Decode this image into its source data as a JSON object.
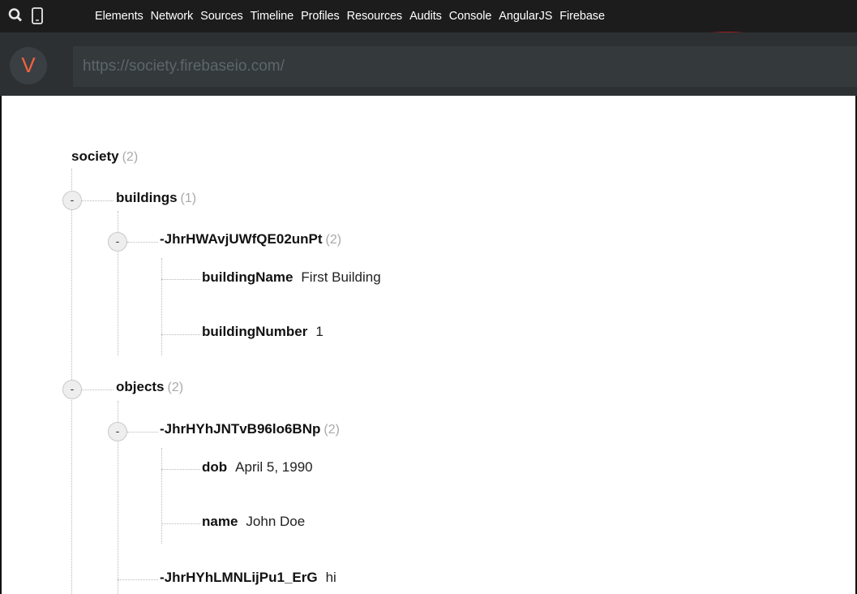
{
  "devtools": {
    "tabs": [
      "Elements",
      "Network",
      "Sources",
      "Timeline",
      "Profiles",
      "Resources",
      "Audits",
      "Console",
      "AngularJS",
      "Firebase"
    ],
    "highlight_color": "#e21b1b"
  },
  "firebase": {
    "logo_letter": "V",
    "url_placeholder": "https://society.firebaseio.com/"
  },
  "tree": {
    "root": {
      "key": "society",
      "count": "(2)"
    },
    "buildings": {
      "key": "buildings",
      "count": "(1)",
      "toggle": "-"
    },
    "building_record": {
      "key": "-JhrHWAvjUWfQE02unPt",
      "count": "(2)",
      "toggle": "-"
    },
    "building_name": {
      "key": "buildingName",
      "value": "First Building"
    },
    "building_number": {
      "key": "buildingNumber",
      "value": "1"
    },
    "objects": {
      "key": "objects",
      "count": "(2)",
      "toggle": "-"
    },
    "object_record": {
      "key": "-JhrHYhJNTvB96lo6BNp",
      "count": "(2)",
      "toggle": "-"
    },
    "dob": {
      "key": "dob",
      "value": "April 5, 1990"
    },
    "name": {
      "key": "name",
      "value": "John Doe"
    },
    "object_leaf": {
      "key": "-JhrHYhLMNLijPu1_ErG",
      "value": "hi"
    }
  }
}
